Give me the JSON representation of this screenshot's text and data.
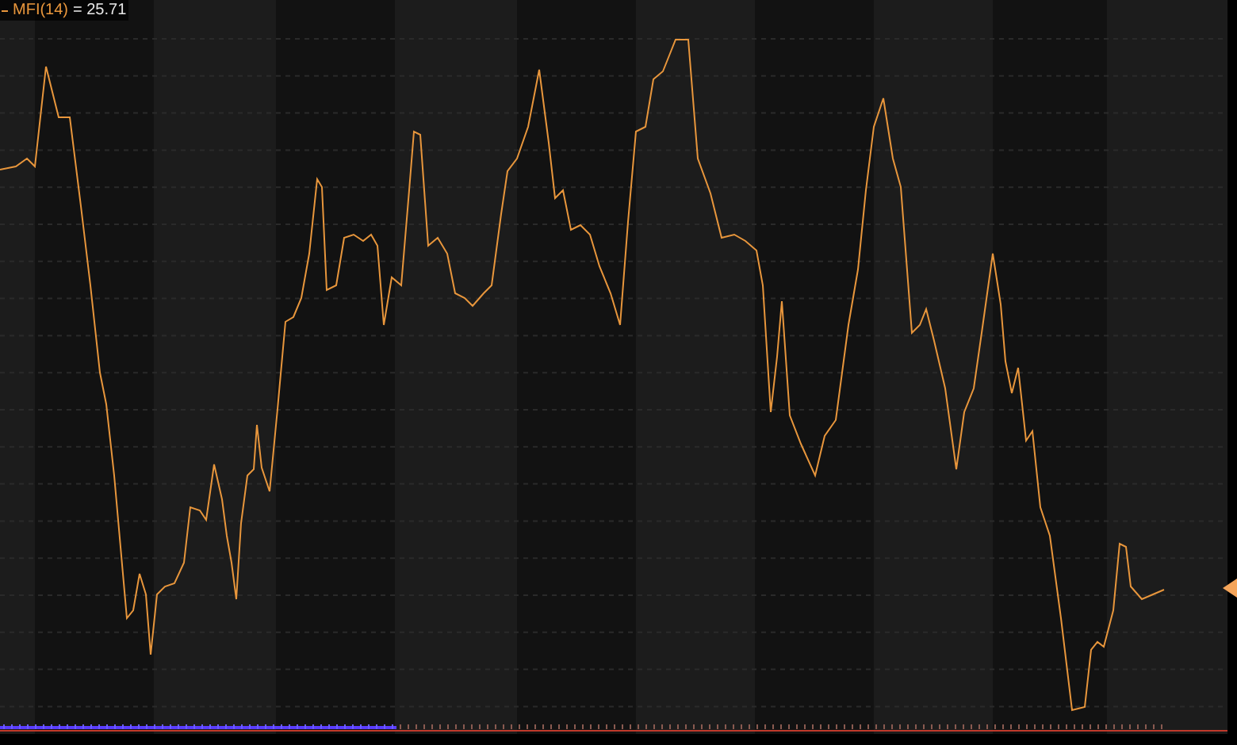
{
  "legend": {
    "label": "MFI(14)",
    "value": "= 25.71"
  }
}
